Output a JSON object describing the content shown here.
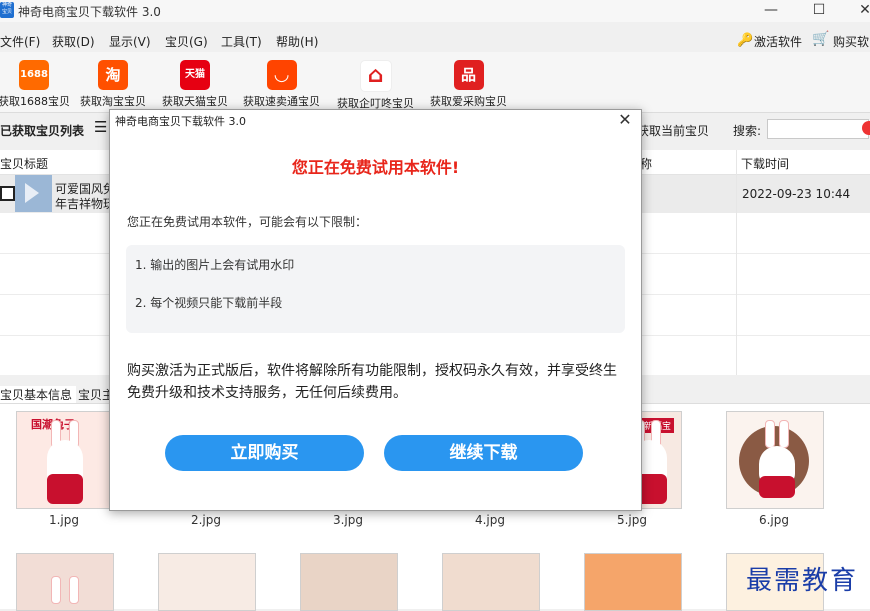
{
  "window": {
    "title": "神奇电商宝贝下载软件 3.0",
    "icon_text": "神奇 宝贝",
    "controls": [
      "—",
      "☐",
      "✕"
    ]
  },
  "menu": [
    "文件(F)",
    "获取(D)",
    "显示(V)",
    "宝贝(G)",
    "工具(T)",
    "帮助(H)"
  ],
  "menu_right": {
    "activate": "激活软件",
    "buy": "购买软"
  },
  "toolbar": [
    {
      "label": "获取1688宝贝",
      "icon": "1688",
      "color": "#ff6a00"
    },
    {
      "label": "获取淘宝宝贝",
      "icon": "淘",
      "color": "#ff5000"
    },
    {
      "label": "获取天猫宝贝",
      "icon": "天猫",
      "color": "#e60012"
    },
    {
      "label": "获取速卖通宝贝",
      "icon": "◡",
      "color": "#ff4400"
    },
    {
      "label": "获取企叮咚宝贝",
      "icon": "⌂",
      "color": "#e02020"
    },
    {
      "label": "获取爱采购宝贝",
      "icon": "品",
      "color": "#e02020"
    }
  ],
  "list_toolbar": {
    "title": "已获取宝贝列表",
    "get_current": "获取当前宝贝",
    "search_label": "搜索:",
    "search_value": ""
  },
  "table": {
    "headers": [
      "宝贝标题",
      "称",
      "下载时间"
    ],
    "rows": [
      {
        "title_line1": "可爱国风兔",
        "title_line2": "年吉祥物玩",
        "time": "2022-09-23 10:44"
      }
    ]
  },
  "bottom_tabs": [
    "宝贝基本信息",
    "宝贝主"
  ],
  "thumbnails": [
    "1.jpg",
    "2.jpg",
    "3.jpg",
    "4.jpg",
    "5.jpg",
    "6.jpg"
  ],
  "thumb_banner_1": "国潮兔子",
  "thumb_banner_5": "新福宝",
  "modal": {
    "title": "神奇电商宝贝下载软件 3.0",
    "close": "✕",
    "heading": "您正在免费试用本软件!",
    "intro": "您正在免费试用本软件，可能会有以下限制：",
    "limits": [
      "1. 输出的图片上会有试用水印",
      "2. 每个视频只能下载前半段"
    ],
    "description": "购买激活为正式版后，软件将解除所有功能限制，授权码永久有效，并享受终生免费升级和技术支持服务，无任何后续费用。",
    "buy_button": "立即购买",
    "continue_button": "继续下载"
  },
  "watermark": "最需教育",
  "colors": {
    "accent": "#2a96f0",
    "heading_red": "#e8261b"
  }
}
